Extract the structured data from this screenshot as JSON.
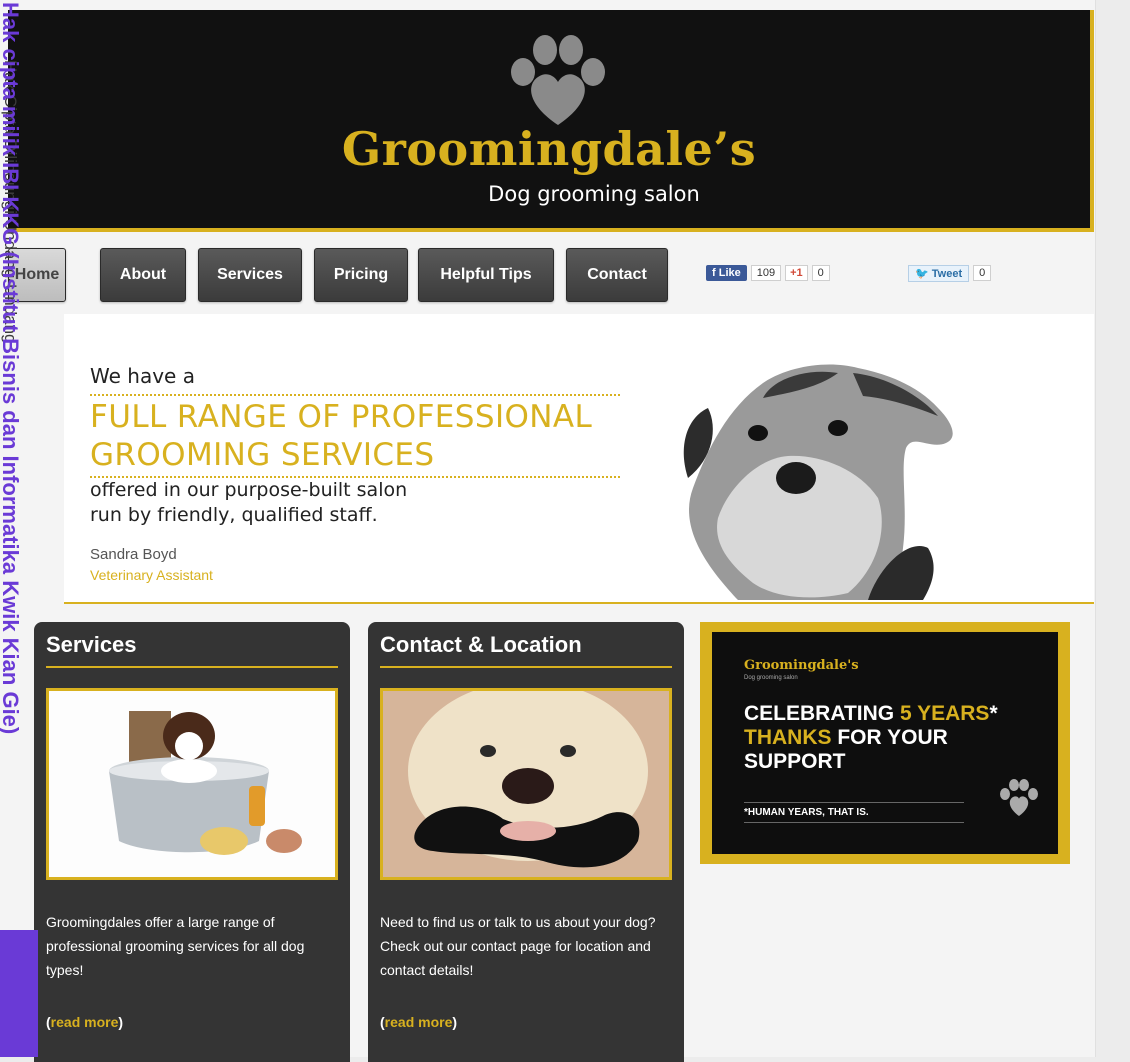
{
  "header": {
    "brand": "Groomingdale’s",
    "tagline": "Dog grooming salon"
  },
  "nav": {
    "items": [
      {
        "label": "Home",
        "active": true
      },
      {
        "label": "About"
      },
      {
        "label": "Services"
      },
      {
        "label": "Pricing"
      },
      {
        "label": "Helpful Tips"
      },
      {
        "label": "Contact"
      }
    ],
    "social": {
      "facebook_label": "Like",
      "facebook_count": "109",
      "google_label": "+1",
      "google_count": "0",
      "twitter_label": "Tweet",
      "twitter_count": "0"
    }
  },
  "hero": {
    "intro": "We have a",
    "headline_1": "FULL RANGE OF PROFESSIONAL",
    "headline_2": "GROOMING SERVICES",
    "sub_1": "offered in our purpose-built salon",
    "sub_2": "run by friendly, qualified staff.",
    "name": "Sandra Boyd",
    "role": "Veterinary Assistant"
  },
  "cards": [
    {
      "title": "Services",
      "desc": "Groomingdales offer a large range of professional grooming services for all dog types!",
      "more_open": "(",
      "more_label": "read more",
      "more_close": ")"
    },
    {
      "title": "Contact & Location",
      "desc": "Need to find us or talk to us about your dog? Check out our contact page for location and contact details!",
      "more_open": "(",
      "more_label": "read more",
      "more_close": ")"
    }
  ],
  "promo": {
    "brand": "Groomingdale's",
    "tag": "Dog grooming salon",
    "line1a": "CELEBRATING ",
    "line1b": "5 YEARS",
    "line1c": "*",
    "line2a": "THANKS",
    "line2b": " FOR YOUR",
    "line3": "SUPPORT",
    "small": "*HUMAN YEARS, THAT IS."
  },
  "watermark": {
    "main": "Hak cipta milik IBI KKG (Institut Bisnis dan Informatika Kwik Kian Gie)",
    "side": "Hak Cipta Dilindungi Undang-Undang"
  },
  "colors": {
    "accent": "#d8b11f",
    "header_bg": "#111111",
    "card_bg": "#343434"
  }
}
